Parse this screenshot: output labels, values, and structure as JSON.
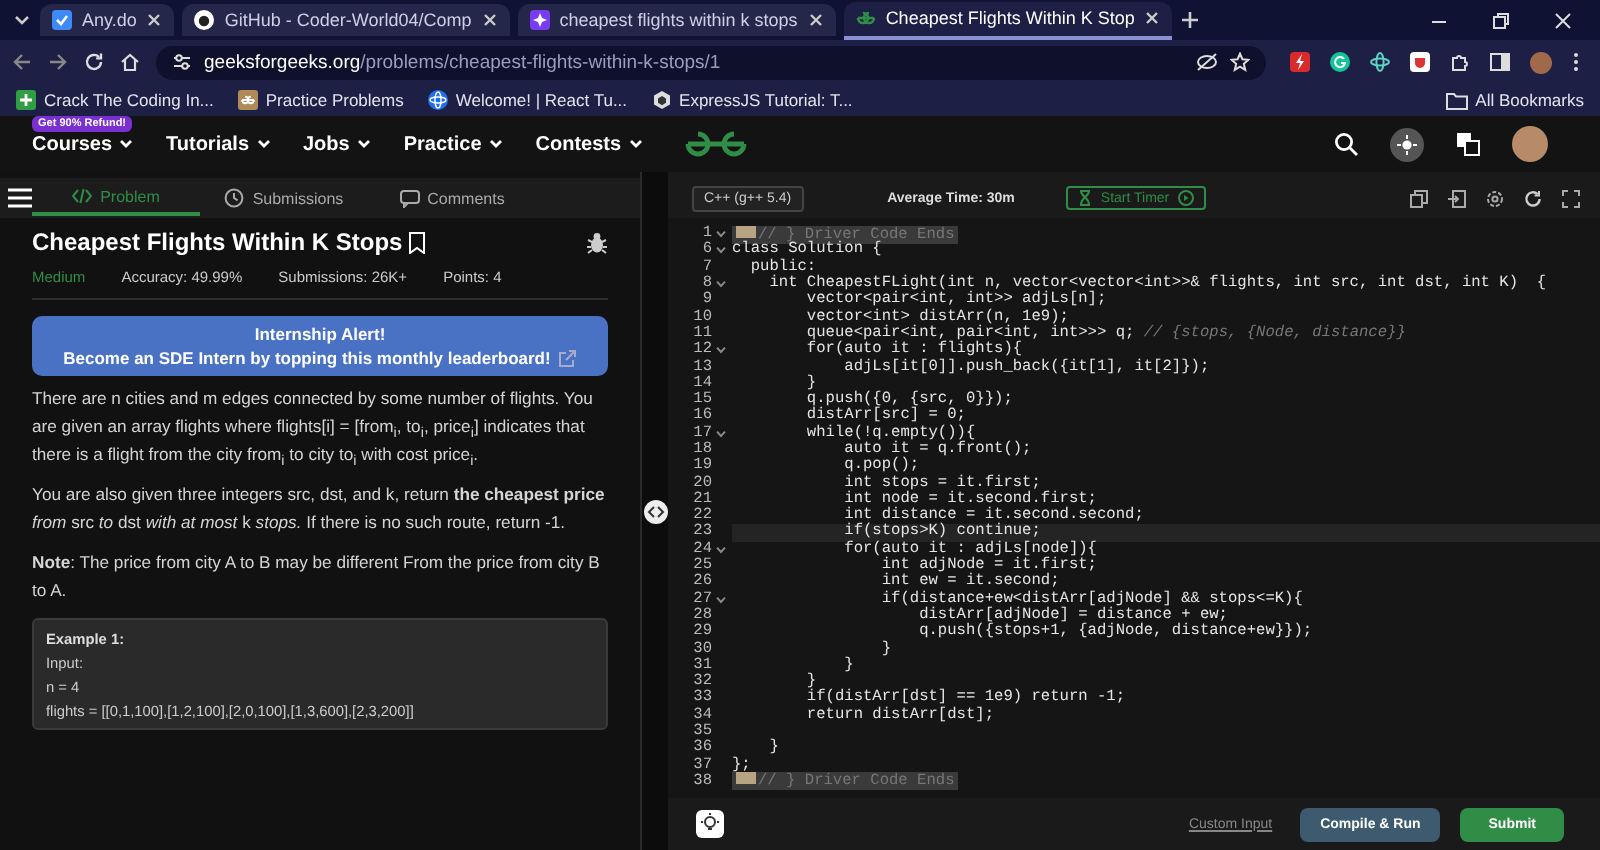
{
  "browser": {
    "tabs": [
      {
        "title": "Any.do",
        "kind": "todo",
        "selected": false
      },
      {
        "title": "GitHub - Coder-World04/Comp",
        "kind": "github",
        "selected": false
      },
      {
        "title": "cheapest flights within k stops",
        "kind": "ai",
        "selected": false
      },
      {
        "title": "Cheapest Flights Within K Stop",
        "kind": "gfg",
        "selected": true
      }
    ],
    "url": {
      "domain": "geeksforgeeks.org",
      "path": "/problems/cheapest-flights-within-k-stops/1"
    },
    "bookmarks": [
      {
        "title": "Crack The Coding In...",
        "kind": "plus"
      },
      {
        "title": "Practice Problems",
        "kind": "gfg"
      },
      {
        "title": "Welcome! | React Tu...",
        "kind": "react"
      },
      {
        "title": "ExpressJS Tutorial: T...",
        "kind": "hex"
      }
    ],
    "all_bookmarks": "All Bookmarks"
  },
  "site_nav": {
    "badge": "Get 90% Refund!",
    "menus": [
      "Courses",
      "Tutorials",
      "Jobs",
      "Practice",
      "Contests"
    ]
  },
  "problem_tabs": [
    {
      "label": "Problem",
      "selected": true
    },
    {
      "label": "Submissions",
      "selected": false
    },
    {
      "label": "Comments",
      "selected": false
    }
  ],
  "problem": {
    "title": "Cheapest Flights Within K Stops",
    "difficulty": "Medium",
    "stats": [
      "Accuracy: 49.99%",
      "Submissions: 26K+",
      "Points: 4"
    ],
    "banner": {
      "heading": "Internship Alert!",
      "text": "Become an SDE Intern by topping this monthly leaderboard!"
    },
    "paragraphs": [
      "There are n cities and m edges connected by some number of flights. You are given an array flights where flights[i] = [from$_{i}$, to$_{i}$, price$_{i}$] indicates that there is a flight from the city from$_{i}$ to city to$_{i}$ with cost price$_{i}$.",
      "You are also given three integers src, dst, and k, return **the cheapest price** *from* src *to* dst *with at most* k *stops.* If there is no such route, return -1.",
      "**Note**: The price from city A to B may be different From the price from city B to A."
    ],
    "example": {
      "title": "Example 1:",
      "lines": [
        "Input:",
        "n = 4",
        "flights = [[0,1,100],[1,2,100],[2,0,100],[1,3,600],[2,3,200]]"
      ]
    }
  },
  "editor": {
    "language": "C++ (g++ 5.4)",
    "average_time": "Average Time: 30m",
    "timer": "Start Timer",
    "lines": [
      {
        "number": "1",
        "kind": "folded",
        "fold": true,
        "text": "// } Driver Code Ends"
      },
      {
        "number": "6",
        "kind": "code",
        "fold": true,
        "text": "class Solution {"
      },
      {
        "number": "7",
        "kind": "code",
        "fold": false,
        "text": "  public:"
      },
      {
        "number": "8",
        "kind": "code",
        "fold": true,
        "text": "    int CheapestFLight(int n, vector<vector<int>>& flights, int src, int dst, int K)  {"
      },
      {
        "number": "9",
        "kind": "code",
        "fold": false,
        "text": "        vector<pair<int, int>> adjLs[n];"
      },
      {
        "number": "10",
        "kind": "code",
        "fold": false,
        "text": "        vector<int> distArr(n, 1e9);"
      },
      {
        "number": "11",
        "kind": "code",
        "fold": false,
        "text": "        queue<pair<int, pair<int, int>>> q;",
        "comment": "// {stops, {Node, distance}}"
      },
      {
        "number": "12",
        "kind": "code",
        "fold": true,
        "text": "        for(auto it : flights){"
      },
      {
        "number": "13",
        "kind": "code",
        "fold": false,
        "text": "            adjLs[it[0]].push_back({it[1], it[2]});"
      },
      {
        "number": "14",
        "kind": "code",
        "fold": false,
        "text": "        }"
      },
      {
        "number": "15",
        "kind": "code",
        "fold": false,
        "text": "        q.push({0, {src, 0}});"
      },
      {
        "number": "16",
        "kind": "code",
        "fold": false,
        "text": "        distArr[src] = 0;"
      },
      {
        "number": "17",
        "kind": "code",
        "fold": true,
        "text": "        while(!q.empty()){"
      },
      {
        "number": "18",
        "kind": "code",
        "fold": false,
        "text": "            auto it = q.front();"
      },
      {
        "number": "19",
        "kind": "code",
        "fold": false,
        "text": "            q.pop();"
      },
      {
        "number": "20",
        "kind": "code",
        "fold": false,
        "text": "            int stops = it.first;"
      },
      {
        "number": "21",
        "kind": "code",
        "fold": false,
        "text": "            int node = it.second.first;"
      },
      {
        "number": "22",
        "kind": "code",
        "fold": false,
        "text": "            int distance = it.second.second;"
      },
      {
        "number": "23",
        "kind": "code",
        "fold": false,
        "selected": true,
        "text": "            if(stops>K) continue;"
      },
      {
        "number": "24",
        "kind": "code",
        "fold": true,
        "text": "            for(auto it : adjLs[node]){"
      },
      {
        "number": "25",
        "kind": "code",
        "fold": false,
        "text": "                int adjNode = it.first;"
      },
      {
        "number": "26",
        "kind": "code",
        "fold": false,
        "text": "                int ew = it.second;"
      },
      {
        "number": "27",
        "kind": "code",
        "fold": true,
        "text": "                if(distance+ew<distArr[adjNode] && stops<=K){"
      },
      {
        "number": "28",
        "kind": "code",
        "fold": false,
        "text": "                    distArr[adjNode] = distance + ew;"
      },
      {
        "number": "29",
        "kind": "code",
        "fold": false,
        "text": "                    q.push({stops+1, {adjNode, distance+ew}});"
      },
      {
        "number": "30",
        "kind": "code",
        "fold": false,
        "text": "                }"
      },
      {
        "number": "31",
        "kind": "code",
        "fold": false,
        "text": "            }"
      },
      {
        "number": "32",
        "kind": "code",
        "fold": false,
        "text": "        }"
      },
      {
        "number": "33",
        "kind": "code",
        "fold": false,
        "text": "        if(distArr[dst] == 1e9) return -1;"
      },
      {
        "number": "34",
        "kind": "code",
        "fold": false,
        "text": "        return distArr[dst];"
      },
      {
        "number": "35",
        "kind": "code",
        "fold": false
      },
      {
        "number": "36",
        "kind": "code",
        "fold": false,
        "text": "    }"
      },
      {
        "number": "37",
        "kind": "code",
        "fold": false,
        "text": "};"
      },
      {
        "number": "38",
        "kind": "folded",
        "fold": false,
        "text": "// } Driver Code Ends"
      }
    ],
    "custom_input": "Custom Input",
    "compile": "Compile & Run",
    "submit": "Submit"
  }
}
